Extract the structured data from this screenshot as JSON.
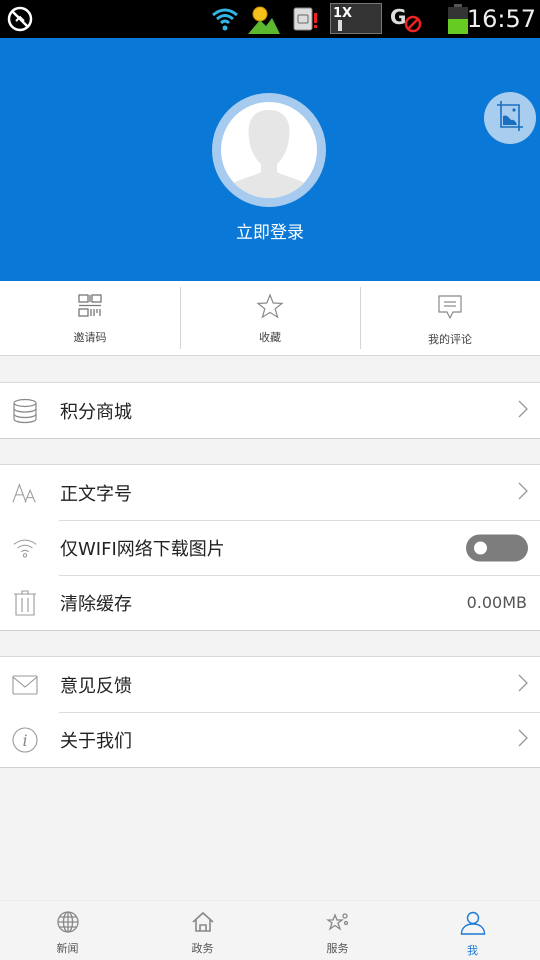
{
  "status_bar": {
    "time": "16:57",
    "icons": [
      "no-sync-icon",
      "wifi-icon",
      "weather-icon",
      "sim-alert-icon",
      "1x-signal-icon",
      "gps-off-icon",
      "battery-icon"
    ]
  },
  "header": {
    "login_label": "立即登录",
    "accent_color": "#0a78d6",
    "avatar_icon": "default-avatar-icon",
    "corner_button_icon": "crop-image-icon"
  },
  "quick_actions": [
    {
      "label": "邀请码",
      "icon": "qr-code-icon"
    },
    {
      "label": "收藏",
      "icon": "star-icon"
    },
    {
      "label": "我的评论",
      "icon": "comment-icon"
    }
  ],
  "groups": [
    {
      "rows": [
        {
          "label": "积分商城",
          "icon": "database-icon",
          "trailing": "chevron"
        }
      ]
    },
    {
      "rows": [
        {
          "label": "正文字号",
          "icon": "font-size-icon",
          "trailing": "chevron"
        },
        {
          "label": "仅WIFI网络下载图片",
          "icon": "wifi-icon",
          "trailing": "toggle",
          "toggle_on": false
        },
        {
          "label": "清除缓存",
          "icon": "trash-icon",
          "trailing": "value",
          "value": "0.00MB"
        }
      ]
    },
    {
      "rows": [
        {
          "label": "意见反馈",
          "icon": "mail-icon",
          "trailing": "chevron"
        },
        {
          "label": "关于我们",
          "icon": "info-icon",
          "trailing": "chevron"
        }
      ]
    }
  ],
  "tabbar": {
    "tabs": [
      {
        "label": "新闻",
        "icon": "globe-icon",
        "active": false
      },
      {
        "label": "政务",
        "icon": "home-icon",
        "active": false
      },
      {
        "label": "服务",
        "icon": "service-star-icon",
        "active": false
      },
      {
        "label": "我",
        "icon": "user-icon",
        "active": true
      }
    ],
    "active_color": "#1a7ad4"
  }
}
